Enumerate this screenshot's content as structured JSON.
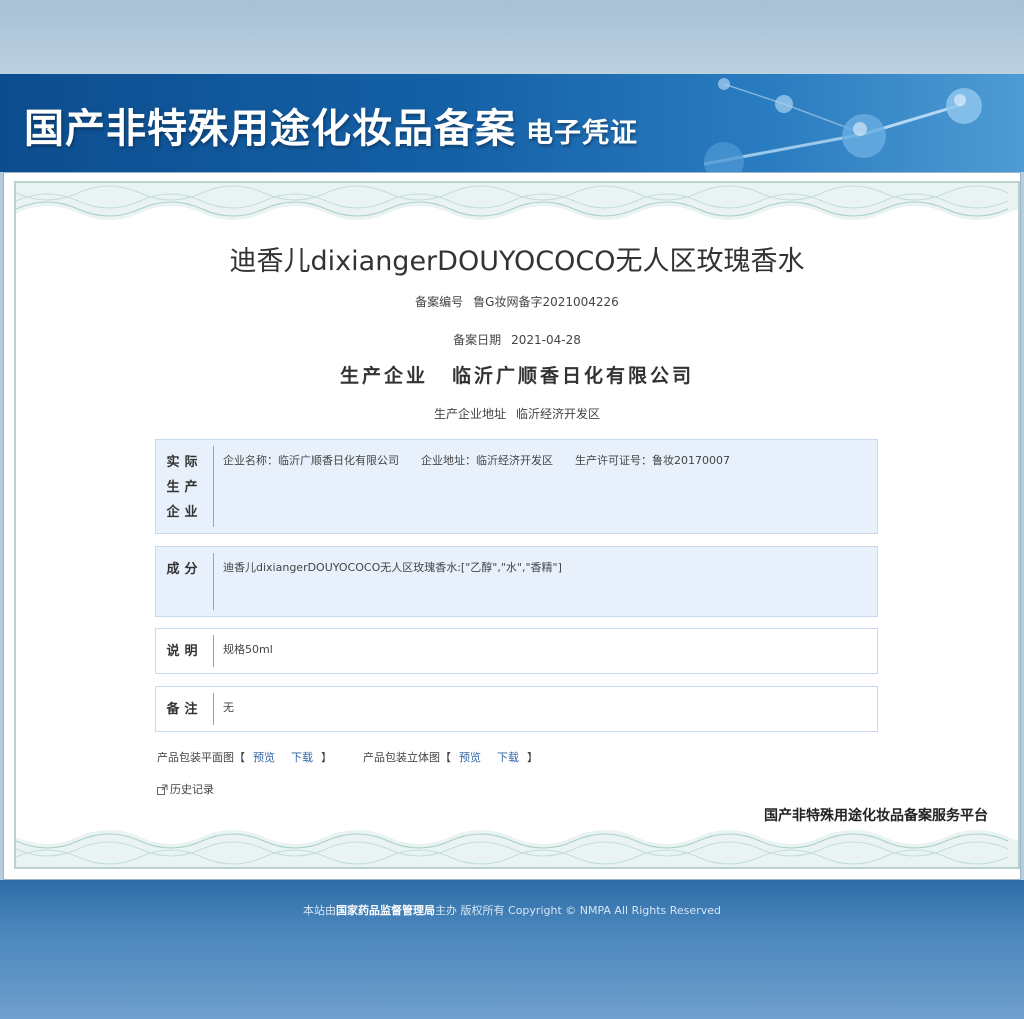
{
  "banner": {
    "title": "国产非特殊用途化妆品备案",
    "subtitle": "电子凭证"
  },
  "product": {
    "name": "迪香儿dixiangerDOUYOCOCO无人区玫瑰香水"
  },
  "filing": {
    "number_label": "备案编号",
    "number_value": "鲁G妆网备字2021004226",
    "date_label": "备案日期",
    "date_value": "2021-04-28",
    "company_label": "生产企业",
    "company_value": "临沂广顺香日化有限公司",
    "address_label": "生产企业地址",
    "address_value": "临沂经济开发区"
  },
  "sections": {
    "actual_producer": {
      "heading_lines": [
        "实际",
        "生产",
        "企业"
      ],
      "name_field": "企业名称：临沂广顺香日化有限公司",
      "address_field": "企业地址：临沂经济开发区",
      "license_field": "生产许可证号：鲁妆20170007"
    },
    "ingredients": {
      "heading": "成分",
      "content": "迪香儿dixiangerDOUYOCOCO无人区玫瑰香水:[\"乙醇\",\"水\",\"香精\"]"
    },
    "description": {
      "heading": "说明",
      "content": "规格50ml"
    },
    "remarks": {
      "heading": "备注",
      "content": "无"
    }
  },
  "packaging": {
    "flat_label": "产品包装平面图",
    "solid_label": "产品包装立体图",
    "bracket_open": "【",
    "bracket_close": "】",
    "preview": "预览",
    "download": "下载"
  },
  "history": {
    "label": "历史记录",
    "icon": "external-link-icon"
  },
  "platform_name": "国产非特殊用途化妆品备案服务平台",
  "footer": {
    "prefix": "本站由",
    "org": "国家药品监督管理局",
    "suffix": "主办 版权所有 Copyright © NMPA All Rights Reserved"
  },
  "colors": {
    "banner": "#1561a7",
    "box_shaded": "#e8f1fb",
    "link": "#3366aa",
    "footer": "#4a86bc"
  }
}
